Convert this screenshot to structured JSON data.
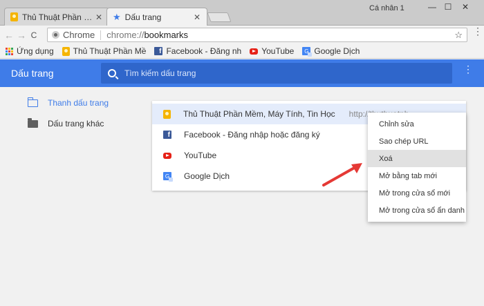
{
  "tabs": [
    {
      "title": "Thủ Thuật Phần Mềm, Máy Tính, Tin Học",
      "close": "✕",
      "active": false
    },
    {
      "title": "Dấu trang",
      "close": "✕",
      "active": true
    }
  ],
  "window": {
    "profile": "Cá nhân 1",
    "minimize": "—",
    "maximize": "☐",
    "close": "✕"
  },
  "toolbar": {
    "back": "←",
    "forward": "→",
    "reload": "C",
    "omnibox_label": "Chrome",
    "url_prefix": "chrome://",
    "url_path": "bookmarks",
    "star": "☆",
    "menu": "⋮"
  },
  "bookmark_bar": [
    {
      "label": "Ứng dụng",
      "icon": "apps-grid-icon"
    },
    {
      "label": "Thủ Thuật Phần Mề",
      "icon": "thuthuat-icon"
    },
    {
      "label": "Facebook - Đăng nh",
      "icon": "facebook-icon"
    },
    {
      "label": "YouTube",
      "icon": "youtube-icon"
    },
    {
      "label": "Google Dịch",
      "icon": "google-translate-icon"
    }
  ],
  "header": {
    "title": "Dấu trang",
    "search_placeholder": "Tìm kiếm dấu trang",
    "menu": "⋮",
    "color": "#3f7ce8"
  },
  "sidebar": {
    "items": [
      {
        "label": "Thanh dấu trang",
        "selected": true
      },
      {
        "label": "Dấu trang khác",
        "selected": false
      }
    ]
  },
  "bookmarks": [
    {
      "title": "Thủ Thuật Phần Mềm, Máy Tính, Tin Học",
      "url": "http://thuthuatph",
      "icon": "thuthuat-icon",
      "selected": true
    },
    {
      "title": "Facebook - Đăng nhập hoặc đăng ký",
      "url": "",
      "icon": "facebook-icon",
      "selected": false
    },
    {
      "title": "YouTube",
      "url": "",
      "icon": "youtube-icon",
      "selected": false
    },
    {
      "title": "Google Dịch",
      "url": "",
      "icon": "google-translate-icon",
      "selected": false
    }
  ],
  "context_menu": {
    "items": [
      {
        "label": "Chỉnh sửa"
      },
      {
        "label": "Sao chép URL"
      },
      {
        "label": "Xoá",
        "hovered": true
      },
      {
        "label": "Mở bằng tab mới"
      },
      {
        "label": "Mở trong cửa sổ mới"
      },
      {
        "label": "Mở trong cửa sổ ẩn danh"
      }
    ]
  },
  "annotation": {
    "arrow_color": "#e53935"
  }
}
